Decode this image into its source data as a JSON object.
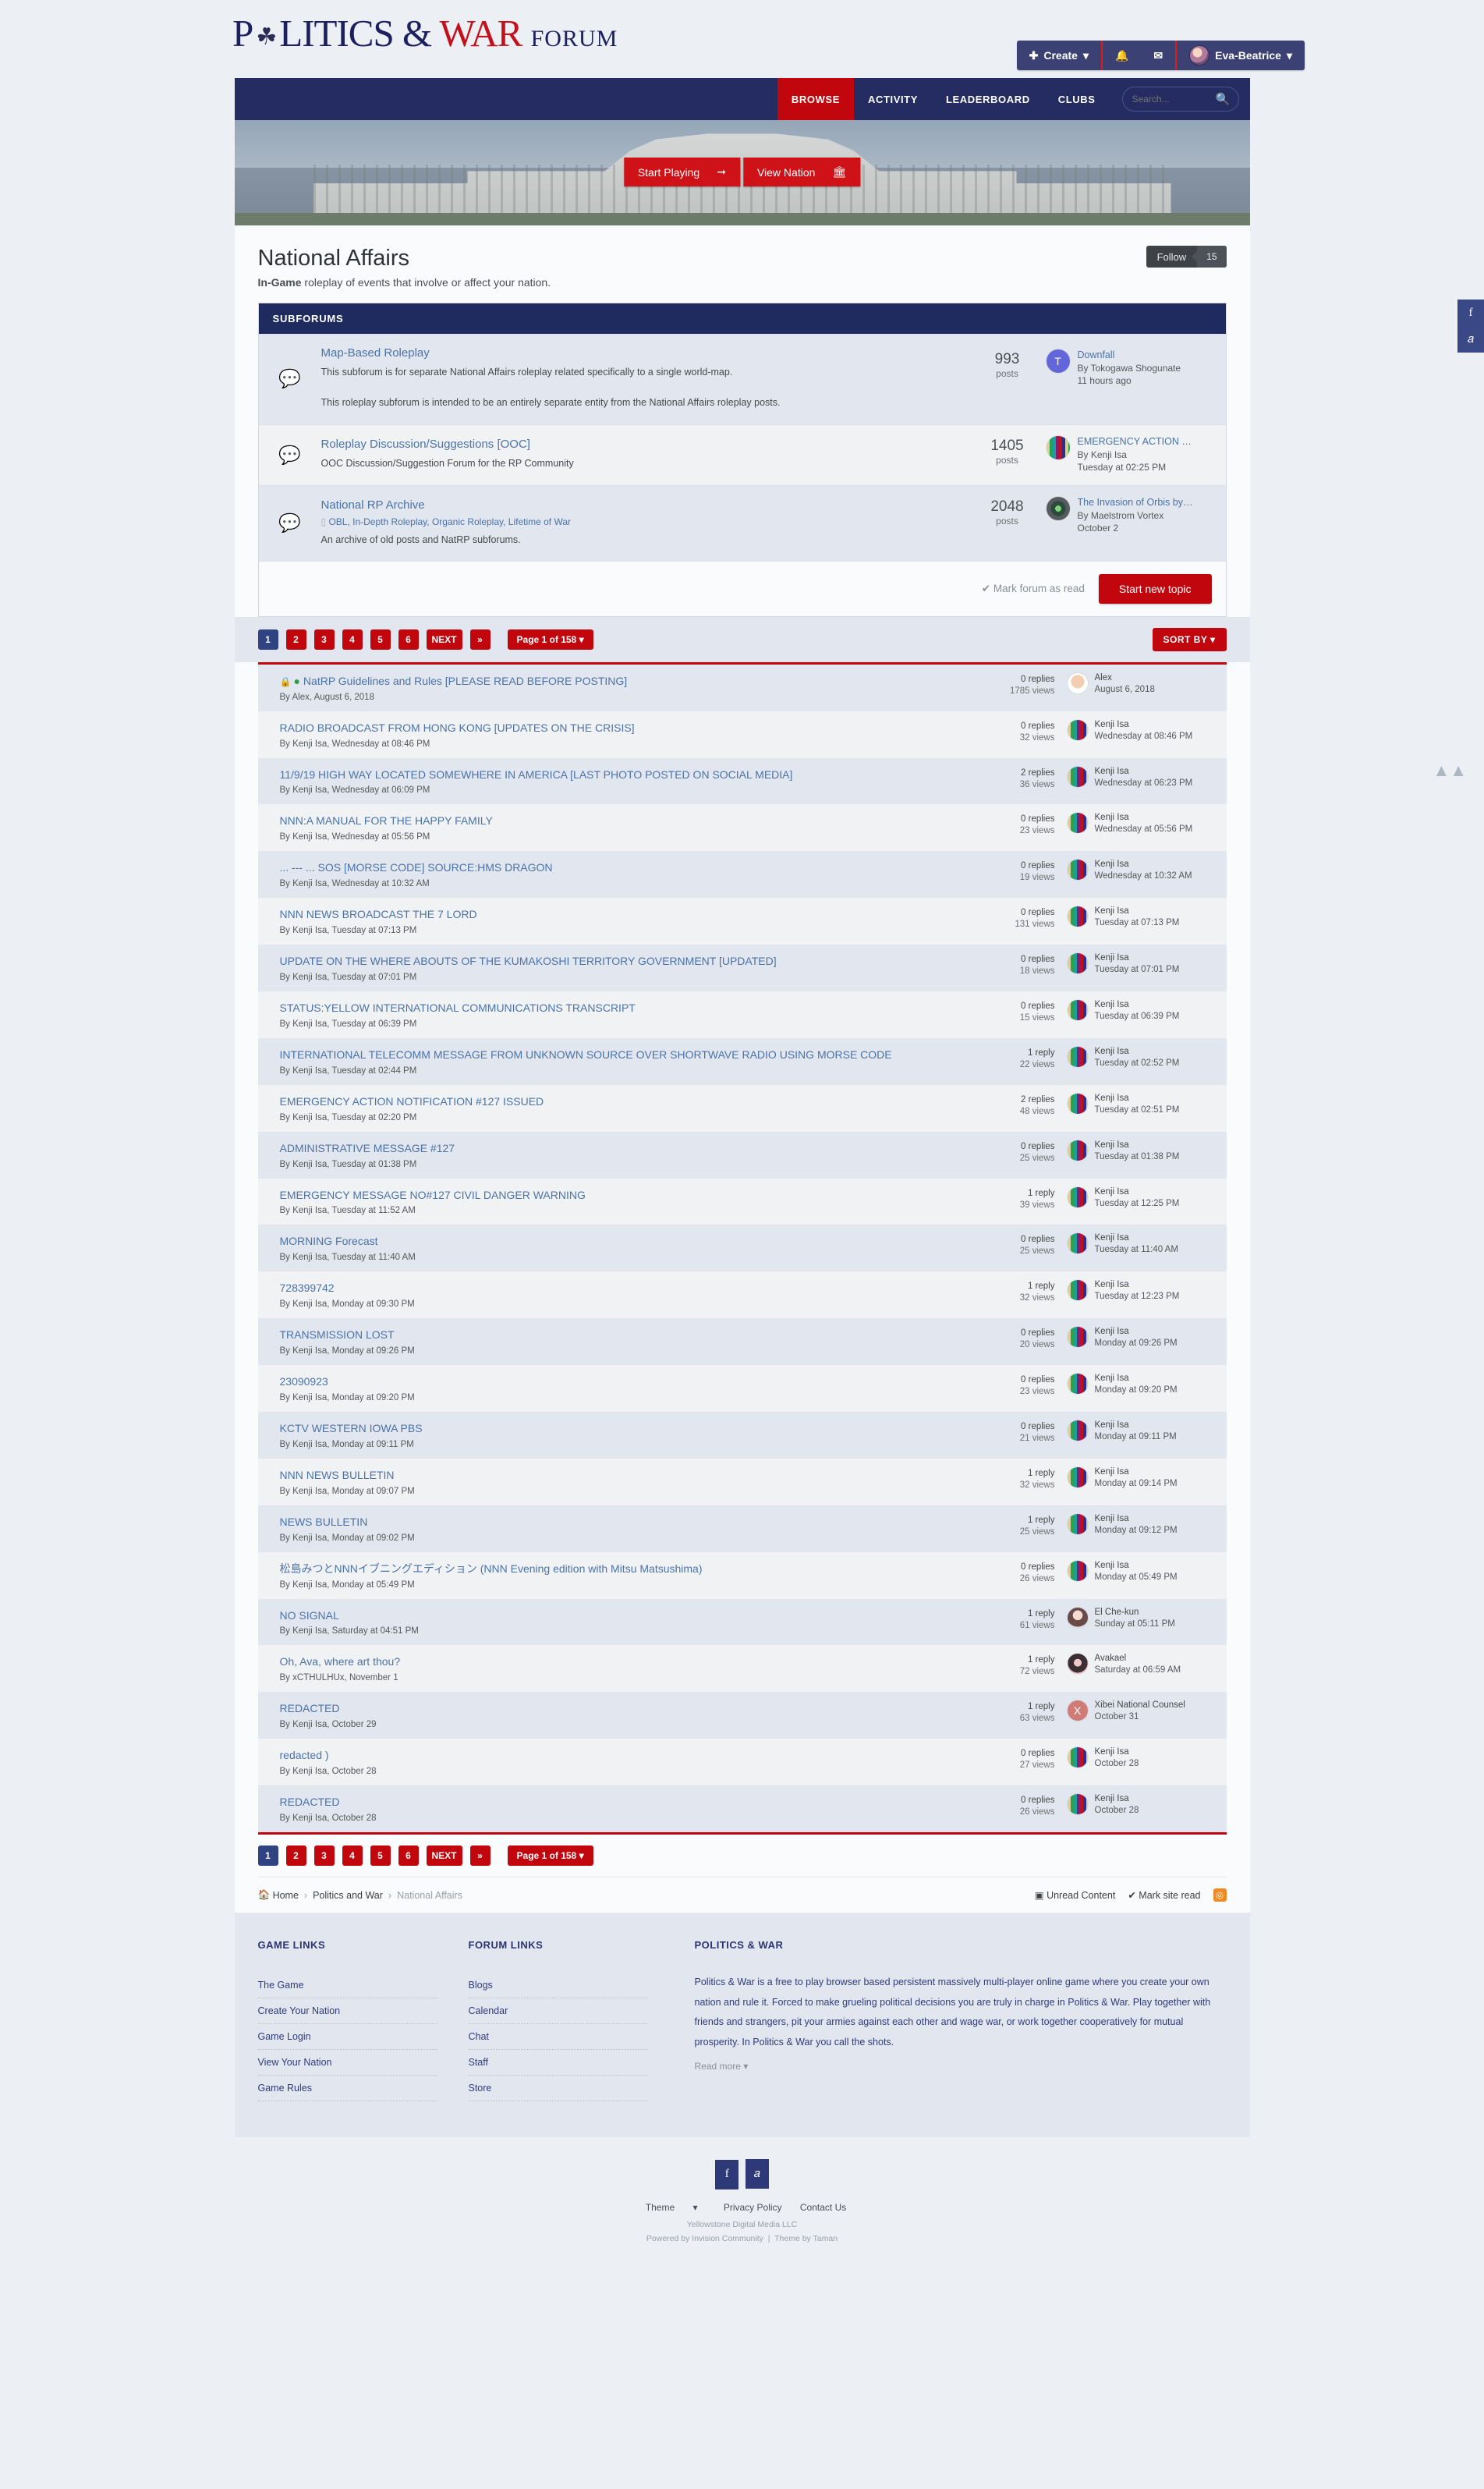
{
  "site": {
    "logo_part1": "P",
    "logo_part2": "LITICS",
    "logo_amp": "&",
    "logo_part3": "W",
    "logo_part4": "AR",
    "logo_suffix": "FORUM"
  },
  "userbar": {
    "create_label": "Create",
    "notifications_icon": "bell-icon",
    "messages_icon": "envelope-icon",
    "username": "Eva-Beatrice"
  },
  "nav": {
    "items": [
      {
        "label": "BROWSE",
        "active": true
      },
      {
        "label": "ACTIVITY",
        "active": false
      },
      {
        "label": "LEADERBOARD",
        "active": false
      },
      {
        "label": "CLUBS",
        "active": false
      }
    ],
    "search_placeholder": "Search...",
    "search_value": ""
  },
  "hero": {
    "start_playing": "Start Playing",
    "view_nation": "View Nation"
  },
  "page": {
    "title": "National Affairs",
    "subtitle_bold": "In-Game",
    "subtitle_rest": " roleplay of events that involve or affect your nation.",
    "follow_label": "Follow",
    "follow_count": "15"
  },
  "subforums": {
    "header": "SUBFORUMS",
    "rows": [
      {
        "title": "Map-Based Roleplay",
        "desc1": "This subforum is for separate National Affairs roleplay related specifically to a single world-map.",
        "desc2": "This roleplay subforum is intended to be an entirely separate entity from the National Affairs roleplay posts.",
        "tags": "",
        "count": "993",
        "count_unit": "posts",
        "last_title": "Downfall",
        "last_by": "By Tokogawa Shogunate",
        "last_time": "11 hours ago",
        "avatar": "letter",
        "avatar_text": "T"
      },
      {
        "title": "Roleplay Discussion/Suggestions [OOC]",
        "desc1": "OOC Discussion/Suggestion Forum for the RP Community",
        "desc2": "",
        "tags": "",
        "count": "1405",
        "count_unit": "posts",
        "last_title": "EMERGENCY ACTION NOTIFICAT...",
        "last_by": "By Kenji Isa",
        "last_time": "Tuesday at 02:25 PM",
        "avatar": "tv",
        "avatar_text": ""
      },
      {
        "title": "National RP Archive",
        "desc1": "An archive of old posts and NatRP subforums.",
        "desc2": "",
        "tags": "OBL,  In-Depth Roleplay,  Organic Roleplay,  Lifetime of War",
        "count": "2048",
        "count_unit": "posts",
        "last_title": "The Invasion of Orbis by t...",
        "last_by": "By Maelstrom Vortex",
        "last_time": "October 2",
        "avatar": "eye",
        "avatar_text": ""
      }
    ],
    "mark_read": "Mark forum as read",
    "start_topic": "Start new topic"
  },
  "pagination": {
    "pages": [
      "1",
      "2",
      "3",
      "4",
      "5",
      "6"
    ],
    "next": "NEXT",
    "last": "»",
    "jump": "Page 1 of 158",
    "sort_by": "SORT BY"
  },
  "topics": [
    {
      "title": "NatRP Guidelines and Rules [PLEASE READ BEFORE POSTING]",
      "locked": true,
      "pinned": true,
      "by": "By Alex, August 6, 2018",
      "replies": "0 replies",
      "views": "1785 views",
      "last_user": "Alex",
      "last_date": "August 6, 2018",
      "avatar": "face"
    },
    {
      "title": "RADIO BROADCAST FROM HONG KONG [UPDATES ON THE CRISIS]",
      "locked": false,
      "pinned": false,
      "by": "By Kenji Isa, Wednesday at 08:46 PM",
      "replies": "0 replies",
      "views": "32 views",
      "last_user": "Kenji Isa",
      "last_date": "Wednesday at 08:46 PM",
      "avatar": "tv"
    },
    {
      "title": "11/9/19 HIGH WAY LOCATED SOMEWHERE IN AMERICA [LAST PHOTO POSTED ON SOCIAL MEDIA]",
      "locked": false,
      "pinned": false,
      "by": "By Kenji Isa, Wednesday at 06:09 PM",
      "replies": "2 replies",
      "views": "36 views",
      "last_user": "Kenji Isa",
      "last_date": "Wednesday at 06:23 PM",
      "avatar": "tv"
    },
    {
      "title": "NNN:A MANUAL FOR THE HAPPY FAMILY",
      "locked": false,
      "pinned": false,
      "by": "By Kenji Isa, Wednesday at 05:56 PM",
      "replies": "0 replies",
      "views": "23 views",
      "last_user": "Kenji Isa",
      "last_date": "Wednesday at 05:56 PM",
      "avatar": "tv"
    },
    {
      "title": "... --- ... SOS [MORSE CODE] SOURCE:HMS DRAGON",
      "locked": false,
      "pinned": false,
      "by": "By Kenji Isa, Wednesday at 10:32 AM",
      "replies": "0 replies",
      "views": "19 views",
      "last_user": "Kenji Isa",
      "last_date": "Wednesday at 10:32 AM",
      "avatar": "tv"
    },
    {
      "title": "NNN NEWS BROADCAST THE 7 LORD",
      "locked": false,
      "pinned": false,
      "by": "By Kenji Isa, Tuesday at 07:13 PM",
      "replies": "0 replies",
      "views": "131 views",
      "last_user": "Kenji Isa",
      "last_date": "Tuesday at 07:13 PM",
      "avatar": "tv"
    },
    {
      "title": "UPDATE ON THE WHERE ABOUTS OF THE KUMAKOSHI TERRITORY GOVERNMENT [UPDATED]",
      "locked": false,
      "pinned": false,
      "by": "By Kenji Isa, Tuesday at 07:01 PM",
      "replies": "0 replies",
      "views": "18 views",
      "last_user": "Kenji Isa",
      "last_date": "Tuesday at 07:01 PM",
      "avatar": "tv"
    },
    {
      "title": "STATUS:YELLOW INTERNATIONAL COMMUNICATIONS TRANSCRIPT",
      "locked": false,
      "pinned": false,
      "by": "By Kenji Isa, Tuesday at 06:39 PM",
      "replies": "0 replies",
      "views": "15 views",
      "last_user": "Kenji Isa",
      "last_date": "Tuesday at 06:39 PM",
      "avatar": "tv"
    },
    {
      "title": "INTERNATIONAL TELECOMM MESSAGE FROM UNKNOWN SOURCE OVER SHORTWAVE RADIO USING MORSE CODE",
      "locked": false,
      "pinned": false,
      "by": "By Kenji Isa, Tuesday at 02:44 PM",
      "replies": "1 reply",
      "views": "22 views",
      "last_user": "Kenji Isa",
      "last_date": "Tuesday at 02:52 PM",
      "avatar": "tv"
    },
    {
      "title": "EMERGENCY ACTION NOTIFICATION #127 ISSUED",
      "locked": false,
      "pinned": false,
      "by": "By Kenji Isa, Tuesday at 02:20 PM",
      "replies": "2 replies",
      "views": "48 views",
      "last_user": "Kenji Isa",
      "last_date": "Tuesday at 02:51 PM",
      "avatar": "tv"
    },
    {
      "title": "ADMINISTRATIVE MESSAGE #127",
      "locked": false,
      "pinned": false,
      "by": "By Kenji Isa, Tuesday at 01:38 PM",
      "replies": "0 replies",
      "views": "25 views",
      "last_user": "Kenji Isa",
      "last_date": "Tuesday at 01:38 PM",
      "avatar": "tv"
    },
    {
      "title": "EMERGENCY MESSAGE NO#127 CIVIL DANGER WARNING",
      "locked": false,
      "pinned": false,
      "by": "By Kenji Isa, Tuesday at 11:52 AM",
      "replies": "1 reply",
      "views": "39 views",
      "last_user": "Kenji Isa",
      "last_date": "Tuesday at 12:25 PM",
      "avatar": "tv"
    },
    {
      "title": "MORNING Forecast",
      "locked": false,
      "pinned": false,
      "by": "By Kenji Isa, Tuesday at 11:40 AM",
      "replies": "0 replies",
      "views": "25 views",
      "last_user": "Kenji Isa",
      "last_date": "Tuesday at 11:40 AM",
      "avatar": "tv"
    },
    {
      "title": "728399742",
      "locked": false,
      "pinned": false,
      "by": "By Kenji Isa, Monday at 09:30 PM",
      "replies": "1 reply",
      "views": "32 views",
      "last_user": "Kenji Isa",
      "last_date": "Tuesday at 12:23 PM",
      "avatar": "tv"
    },
    {
      "title": "TRANSMISSION LOST",
      "locked": false,
      "pinned": false,
      "by": "By Kenji Isa, Monday at 09:26 PM",
      "replies": "0 replies",
      "views": "20 views",
      "last_user": "Kenji Isa",
      "last_date": "Monday at 09:26 PM",
      "avatar": "tv"
    },
    {
      "title": "23090923",
      "locked": false,
      "pinned": false,
      "by": "By Kenji Isa, Monday at 09:20 PM",
      "replies": "0 replies",
      "views": "23 views",
      "last_user": "Kenji Isa",
      "last_date": "Monday at 09:20 PM",
      "avatar": "tv"
    },
    {
      "title": "KCTV WESTERN IOWA PBS",
      "locked": false,
      "pinned": false,
      "by": "By Kenji Isa, Monday at 09:11 PM",
      "replies": "0 replies",
      "views": "21 views",
      "last_user": "Kenji Isa",
      "last_date": "Monday at 09:11 PM",
      "avatar": "tv"
    },
    {
      "title": "NNN NEWS BULLETIN",
      "locked": false,
      "pinned": false,
      "by": "By Kenji Isa, Monday at 09:07 PM",
      "replies": "1 reply",
      "views": "32 views",
      "last_user": "Kenji Isa",
      "last_date": "Monday at 09:14 PM",
      "avatar": "tv"
    },
    {
      "title": "NEWS BULLETIN",
      "locked": false,
      "pinned": false,
      "by": "By Kenji Isa, Monday at 09:02 PM",
      "replies": "1 reply",
      "views": "25 views",
      "last_user": "Kenji Isa",
      "last_date": "Monday at 09:12 PM",
      "avatar": "tv"
    },
    {
      "title": "松島みつとNNNイブニングエディション (NNN Evening edition with Mitsu Matsushima)",
      "locked": false,
      "pinned": false,
      "by": "By Kenji Isa, Monday at 05:49 PM",
      "replies": "0 replies",
      "views": "26 views",
      "last_user": "Kenji Isa",
      "last_date": "Monday at 05:49 PM",
      "avatar": "tv"
    },
    {
      "title": "NO SIGNAL",
      "locked": false,
      "pinned": false,
      "by": "By Kenji Isa, Saturday at 04:51 PM",
      "replies": "1 reply",
      "views": "61 views",
      "last_user": "El Che-kun",
      "last_date": "Sunday at 05:11 PM",
      "avatar": "girl"
    },
    {
      "title": "Oh, Ava, where art thou?",
      "locked": false,
      "pinned": false,
      "by": "By xCTHULHUx, November 1",
      "replies": "1 reply",
      "views": "72 views",
      "last_user": "Avakael",
      "last_date": "Saturday at 06:59 AM",
      "avatar": "sing"
    },
    {
      "title": "REDACTED",
      "locked": false,
      "pinned": false,
      "by": "By Kenji Isa, October 29",
      "replies": "1 reply",
      "views": "63 views",
      "last_user": "Xibei National Counsel",
      "last_date": "October 31",
      "avatar": "x"
    },
    {
      "title": "redacted )",
      "locked": false,
      "pinned": false,
      "by": "By Kenji Isa, October 28",
      "replies": "0 replies",
      "views": "27 views",
      "last_user": "Kenji Isa",
      "last_date": "October 28",
      "avatar": "tv"
    },
    {
      "title": "REDACTED",
      "locked": false,
      "pinned": false,
      "by": "By Kenji Isa, October 28",
      "replies": "0 replies",
      "views": "26 views",
      "last_user": "Kenji Isa",
      "last_date": "October 28",
      "avatar": "tv"
    }
  ],
  "breadcrumb": {
    "home": "Home",
    "level1": "Politics and War",
    "current": "National Affairs",
    "unread": "Unread Content",
    "mark_site_read": "Mark site read",
    "rss": "rss-icon"
  },
  "footer": {
    "game_links_head": "GAME LINKS",
    "game_links": [
      "The Game",
      "Create Your Nation",
      "Game Login",
      "View Your Nation",
      "Game Rules"
    ],
    "forum_links_head": "FORUM LINKS",
    "forum_links": [
      "Blogs",
      "Calendar",
      "Chat",
      "Staff",
      "Store"
    ],
    "about_head": "POLITICS & WAR",
    "about_body": "Politics & War is a free to play browser based persistent massively multi-player online game where you create your own nation and rule it. Forced to make grueling political decisions you are truly in charge in Politics & War. Play together with friends and strangers, pit your armies against each other and wage war, or work together cooperatively for mutual prosperity. In Politics & War you call the shots.",
    "read_more": "Read more",
    "theme": "Theme",
    "privacy": "Privacy Policy",
    "contact": "Contact Us",
    "copyright": "Yellowstone Digital Media LLC",
    "powered": "Powered by Invision Community",
    "theme_credit": "Theme by Taman"
  },
  "colors": {
    "brand_red": "#c1060d",
    "brand_navy": "#1f2a5e",
    "link_blue": "#4a73a8"
  }
}
